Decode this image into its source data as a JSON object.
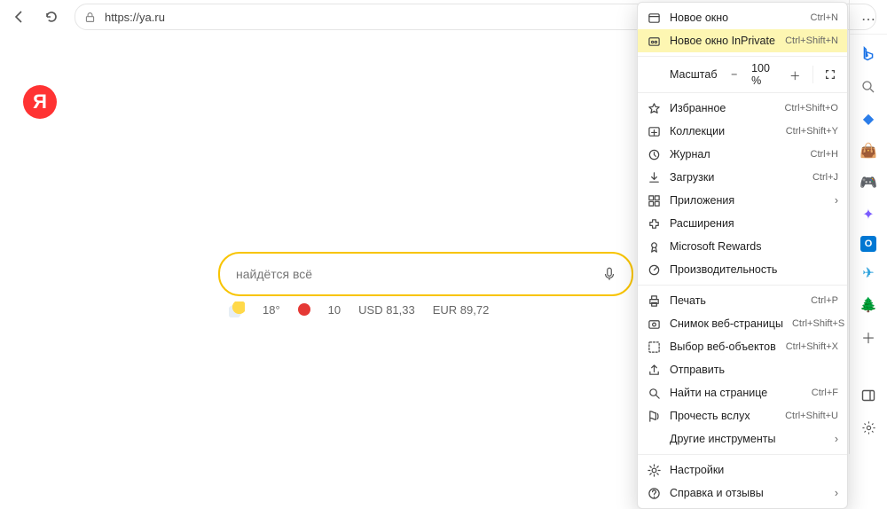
{
  "url": "https://ya.ru",
  "logo_letter": "Я",
  "search_placeholder": "найдётся всё",
  "info": {
    "temp": "18°",
    "air": "10",
    "usd": "USD 81,33",
    "eur": "EUR 89,72"
  },
  "zoom": {
    "label": "Масштаб",
    "value": "100 %"
  },
  "menu": [
    {
      "id": "new-window",
      "label": "Новое окно",
      "shortcut": "Ctrl+N"
    },
    {
      "id": "new-inprivate",
      "label": "Новое окно InPrivate",
      "shortcut": "Ctrl+Shift+N",
      "hl": true
    },
    {
      "id": "favorites",
      "label": "Избранное",
      "shortcut": "Ctrl+Shift+O"
    },
    {
      "id": "collections",
      "label": "Коллекции",
      "shortcut": "Ctrl+Shift+Y"
    },
    {
      "id": "history",
      "label": "Журнал",
      "shortcut": "Ctrl+H"
    },
    {
      "id": "downloads",
      "label": "Загрузки",
      "shortcut": "Ctrl+J"
    },
    {
      "id": "apps",
      "label": "Приложения",
      "chev": true
    },
    {
      "id": "extensions",
      "label": "Расширения"
    },
    {
      "id": "rewards",
      "label": "Microsoft Rewards"
    },
    {
      "id": "perf",
      "label": "Производительность"
    },
    {
      "id": "print",
      "label": "Печать",
      "shortcut": "Ctrl+P"
    },
    {
      "id": "capture",
      "label": "Снимок веб-страницы",
      "shortcut": "Ctrl+Shift+S"
    },
    {
      "id": "webselect",
      "label": "Выбор веб-объектов",
      "shortcut": "Ctrl+Shift+X"
    },
    {
      "id": "share",
      "label": "Отправить"
    },
    {
      "id": "find",
      "label": "Найти на странице",
      "shortcut": "Ctrl+F"
    },
    {
      "id": "readaloud",
      "label": "Прочесть вслух",
      "shortcut": "Ctrl+Shift+U"
    },
    {
      "id": "moretools",
      "label": "Другие инструменты",
      "chev": true,
      "noicon": true
    },
    {
      "id": "settings",
      "label": "Настройки"
    },
    {
      "id": "help",
      "label": "Справка и отзывы",
      "chev": true
    }
  ]
}
